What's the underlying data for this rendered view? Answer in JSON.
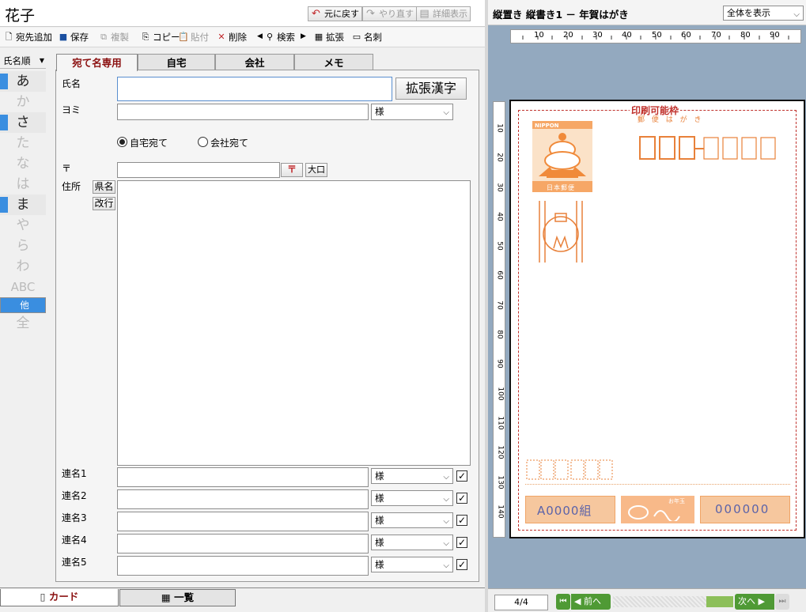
{
  "window": {
    "title": "花子"
  },
  "top_buttons": {
    "undo": "元に戻す",
    "redo": "やり直す",
    "details": "詳細表示"
  },
  "toolbar": {
    "add": "宛先追加",
    "save": "保存",
    "duplicate": "複製",
    "copy": "コピー",
    "paste": "貼付",
    "delete": "削除",
    "search": "検索",
    "expand": "拡張",
    "meishi": "名刺"
  },
  "sidebar": {
    "sort_label": "氏名順",
    "index": [
      "あ",
      "か",
      "さ",
      "た",
      "な",
      "は",
      "ま",
      "やら",
      "ら",
      "わ",
      "ABC",
      "他",
      "全"
    ]
  },
  "tabs": [
    "宛て名専用",
    "自宅",
    "会社",
    "メモ"
  ],
  "form": {
    "name_label": "氏名",
    "name_value": "",
    "kanji_button": "拡張漢字",
    "yomi_label": "ヨミ",
    "yomi_value": "",
    "honorific": "様",
    "radio_home": "自宅宛て",
    "radio_company": "会社宛て",
    "zip_label": "〒",
    "zip_value": "",
    "zip_button": "〒",
    "oguchi_button": "大口",
    "address_label": "住所",
    "pref_button": "県名",
    "newline_button": "改行",
    "renmei": [
      {
        "label": "連名1",
        "value": "",
        "honorific": "様",
        "checked": true
      },
      {
        "label": "連名2",
        "value": "",
        "honorific": "様",
        "checked": true
      },
      {
        "label": "連名3",
        "value": "",
        "honorific": "様",
        "checked": true
      },
      {
        "label": "連名4",
        "value": "",
        "honorific": "様",
        "checked": true
      },
      {
        "label": "連名5",
        "value": "",
        "honorific": "様",
        "checked": true
      }
    ]
  },
  "bottom_tabs": {
    "card": "カード",
    "list": "一覧"
  },
  "preview": {
    "title": "縦置き 縦書き1 － 年賀はがき",
    "zoom_select": "全体を表示",
    "ruler_h": [
      "10",
      "20",
      "30",
      "40",
      "50",
      "60",
      "70",
      "80",
      "90"
    ],
    "ruler_v": [
      "10",
      "20",
      "30",
      "40",
      "50",
      "60",
      "70",
      "80",
      "90",
      "100",
      "110",
      "120",
      "130",
      "140"
    ],
    "print_area_label": "印刷可能枠",
    "postcard_heading": "郵 便 は が き",
    "stamp_top": "NIPPON",
    "stamp_bottom": "日本郵便",
    "lottery_group": "A0000組",
    "lottery_number": "000000",
    "lottery_small": "お年玉"
  },
  "nav": {
    "page": "4/4",
    "prev": "前へ",
    "next": "次へ"
  },
  "colors": {
    "accent": "#3a8ee0",
    "active_tab": "#8b1010",
    "stamp": "#e8813a",
    "frame": "#c0312c",
    "nav_green": "#4f9a35"
  }
}
